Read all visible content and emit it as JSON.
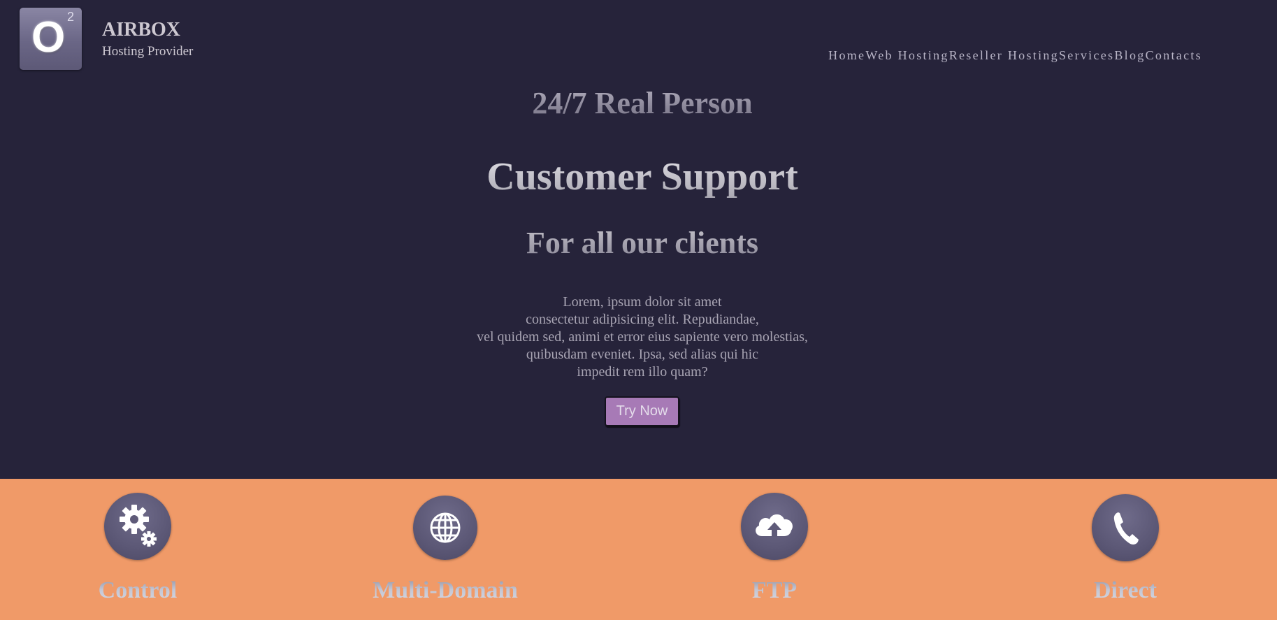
{
  "header": {
    "logo": {
      "letter": "O",
      "superscript": "2"
    },
    "brand_name": "AIRBOX",
    "tagline": "Hosting Provider",
    "nav": [
      {
        "label": "Home"
      },
      {
        "label": "Web Hosting"
      },
      {
        "label": "Reseller Hosting"
      },
      {
        "label": "Services"
      },
      {
        "label": "Blog"
      },
      {
        "label": "Contacts"
      }
    ]
  },
  "hero": {
    "kicker": "24/7 Real Person",
    "title": "Customer Support",
    "subtitle": "For all our clients",
    "body_lines": [
      "Lorem, ipsum dolor sit amet",
      "consectetur adipisicing elit. Repudiandae,",
      "vel quidem sed, animi et error eius sapiente vero molestias,",
      "quibusdam eveniet. Ipsa, sed alias qui hic",
      "impedit rem illo quam?"
    ],
    "cta_label": "Try Now"
  },
  "features": [
    {
      "label": "Control",
      "icon": "gears-icon"
    },
    {
      "label": "Multi-Domain",
      "icon": "globe-icon"
    },
    {
      "label": "FTP",
      "icon": "cloud-upload-icon"
    },
    {
      "label": "Direct",
      "icon": "phone-icon"
    }
  ],
  "colors": {
    "background": "#26233a",
    "features_band": "#f09a68",
    "button": "#a77ab6",
    "icon_circle": "#5b5775"
  }
}
